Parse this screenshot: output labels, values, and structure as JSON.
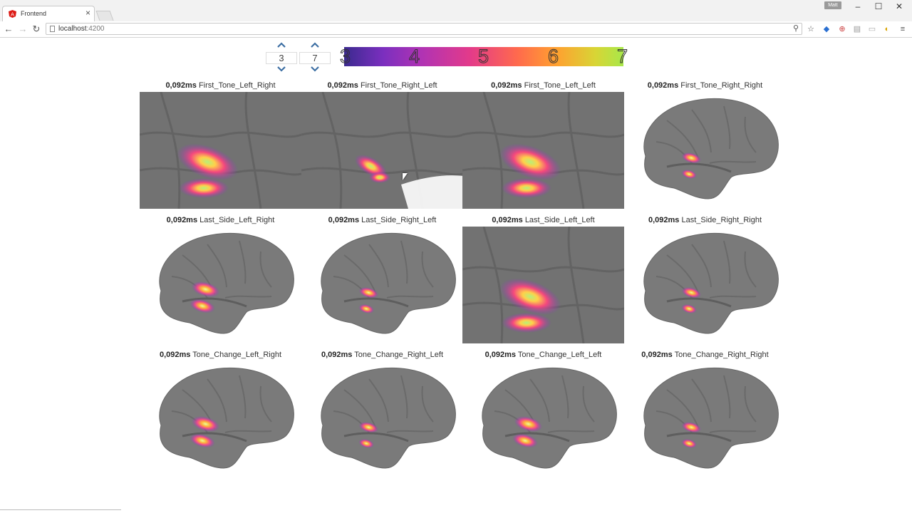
{
  "browser": {
    "tab_title": "Frontend",
    "tab_close": "×",
    "profile": "Matt",
    "url_host": "localhost",
    "url_port": ":4200"
  },
  "controls": {
    "min_value": "3",
    "max_value": "7"
  },
  "colorbar": {
    "labels": [
      "3",
      "4",
      "5",
      "6",
      "7"
    ],
    "colors": [
      "#3b2a8f",
      "#7b2fbf",
      "#b133b3",
      "#e33a8a",
      "#ff6a4d",
      "#ffa030",
      "#d8d535",
      "#a8e84a"
    ]
  },
  "panels": [
    {
      "time": "0,092ms",
      "name": "First_Tone_Left_Right",
      "view": "zoom"
    },
    {
      "time": "0,092ms",
      "name": "First_Tone_Right_Left",
      "view": "zoom"
    },
    {
      "time": "0,092ms",
      "name": "First_Tone_Left_Left",
      "view": "zoom"
    },
    {
      "time": "0,092ms",
      "name": "First_Tone_Right_Right",
      "view": "brain"
    },
    {
      "time": "0,092ms",
      "name": "Last_Side_Left_Right",
      "view": "brain"
    },
    {
      "time": "0,092ms",
      "name": "Last_Side_Right_Left",
      "view": "brain"
    },
    {
      "time": "0,092ms",
      "name": "Last_Side_Left_Left",
      "view": "zoom"
    },
    {
      "time": "0,092ms",
      "name": "Last_Side_Right_Right",
      "view": "brain"
    },
    {
      "time": "0,092ms",
      "name": "Tone_Change_Left_Right",
      "view": "brain"
    },
    {
      "time": "0,092ms",
      "name": "Tone_Change_Right_Left",
      "view": "brain"
    },
    {
      "time": "0,092ms",
      "name": "Tone_Change_Left_Left",
      "view": "brain"
    },
    {
      "time": "0,092ms",
      "name": "Tone_Change_Right_Right",
      "view": "brain"
    }
  ]
}
